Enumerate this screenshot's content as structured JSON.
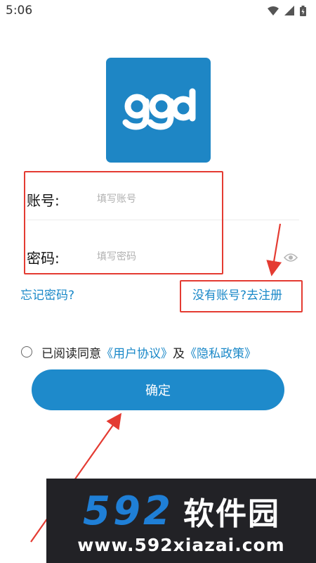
{
  "status_bar": {
    "time": "5:06",
    "icons": [
      "wifi-icon",
      "signal-icon",
      "battery-icon"
    ]
  },
  "logo": {
    "text": "ggd",
    "bg_color": "#1e86c5"
  },
  "form": {
    "account_label": "账号:",
    "account_placeholder": "填写账号",
    "account_value": "",
    "password_label": "密码:",
    "password_placeholder": "填写密码",
    "password_value": "",
    "password_toggle_icon": "eye-icon"
  },
  "links": {
    "forgot_password": "忘记密码?",
    "register": "没有账号?去注册"
  },
  "agreement": {
    "checked": false,
    "prefix": "已阅读同意",
    "user_agreement": "《用户协议》",
    "conjunction": "及",
    "privacy_policy": "《隐私政策》"
  },
  "confirm_button": "确定",
  "watermark": {
    "brand_number": "592",
    "brand_name": "软件园",
    "url": "www.592xiazai.com"
  },
  "colors": {
    "accent": "#1e8acb",
    "link": "#1a88c8",
    "annotation": "#e43b32"
  }
}
